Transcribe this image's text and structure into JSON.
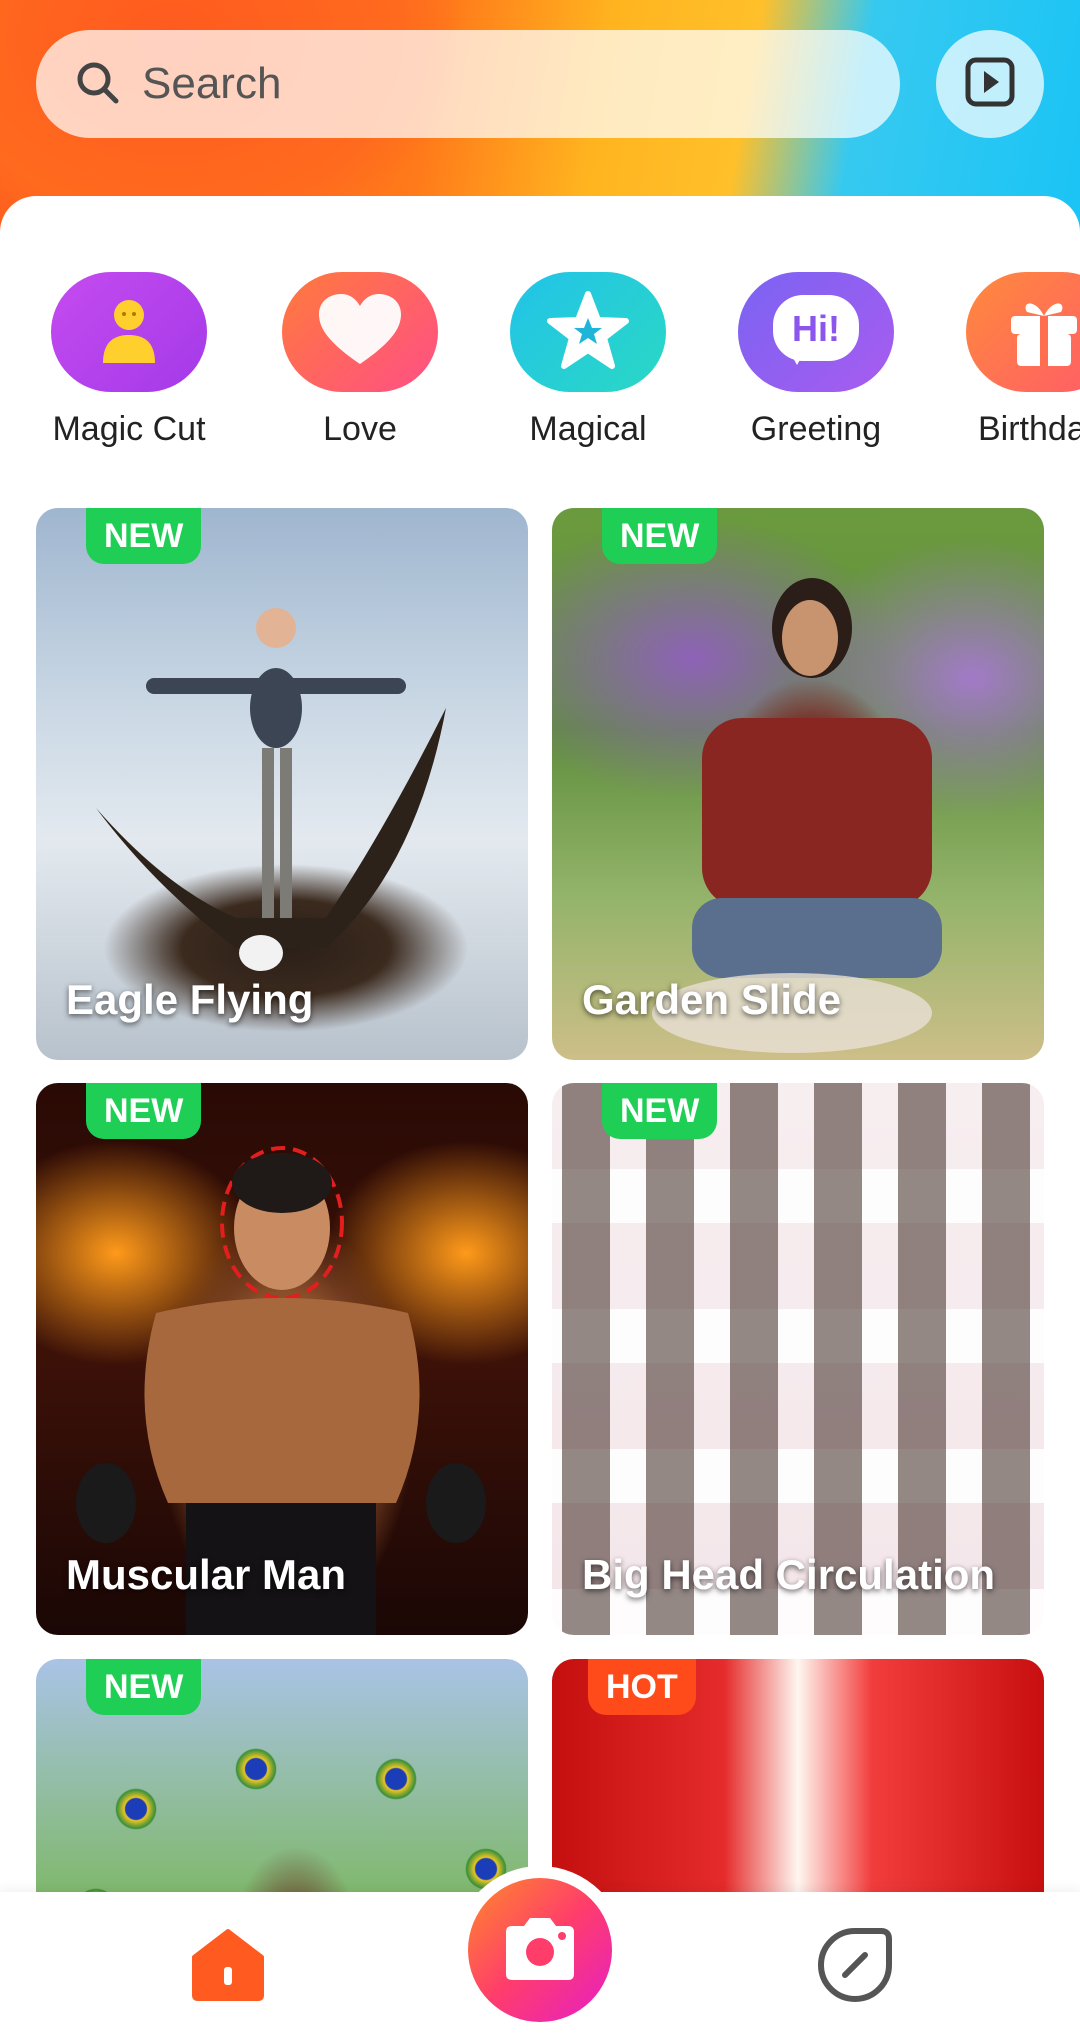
{
  "search": {
    "placeholder": "Search"
  },
  "categories": [
    {
      "label": "Magic Cut",
      "icon": "person-icon",
      "color_from": "#c54bf0",
      "color_to": "#a43ae8"
    },
    {
      "label": "Love",
      "icon": "heart-icon",
      "color_from": "#ff7a3c",
      "color_to": "#ff4f86"
    },
    {
      "label": "Magical",
      "icon": "star-icon",
      "color_from": "#22c3e8",
      "color_to": "#2ad8c4"
    },
    {
      "label": "Greeting",
      "icon": "hi-bubble-icon",
      "color_from": "#7a63f2",
      "color_to": "#a85cf0",
      "bubble_text": "Hi!"
    },
    {
      "label": "Birthda",
      "icon": "gift-icon",
      "color_from": "#ff8a3c",
      "color_to": "#ff5a6a"
    }
  ],
  "templates": [
    {
      "title": "Eagle Flying",
      "badge": "NEW"
    },
    {
      "title": "Garden Slide",
      "badge": "NEW"
    },
    {
      "title": "Muscular Man",
      "badge": "NEW"
    },
    {
      "title": "Big Head Circulation",
      "badge": "NEW"
    },
    {
      "title": "",
      "badge": "NEW"
    },
    {
      "title": "",
      "badge": "HOT"
    }
  ],
  "colors": {
    "badge_new": "#1fcf55",
    "badge_hot": "#ff4a1a",
    "home_active": "#ff5a1f",
    "nav_inactive": "#555555"
  }
}
